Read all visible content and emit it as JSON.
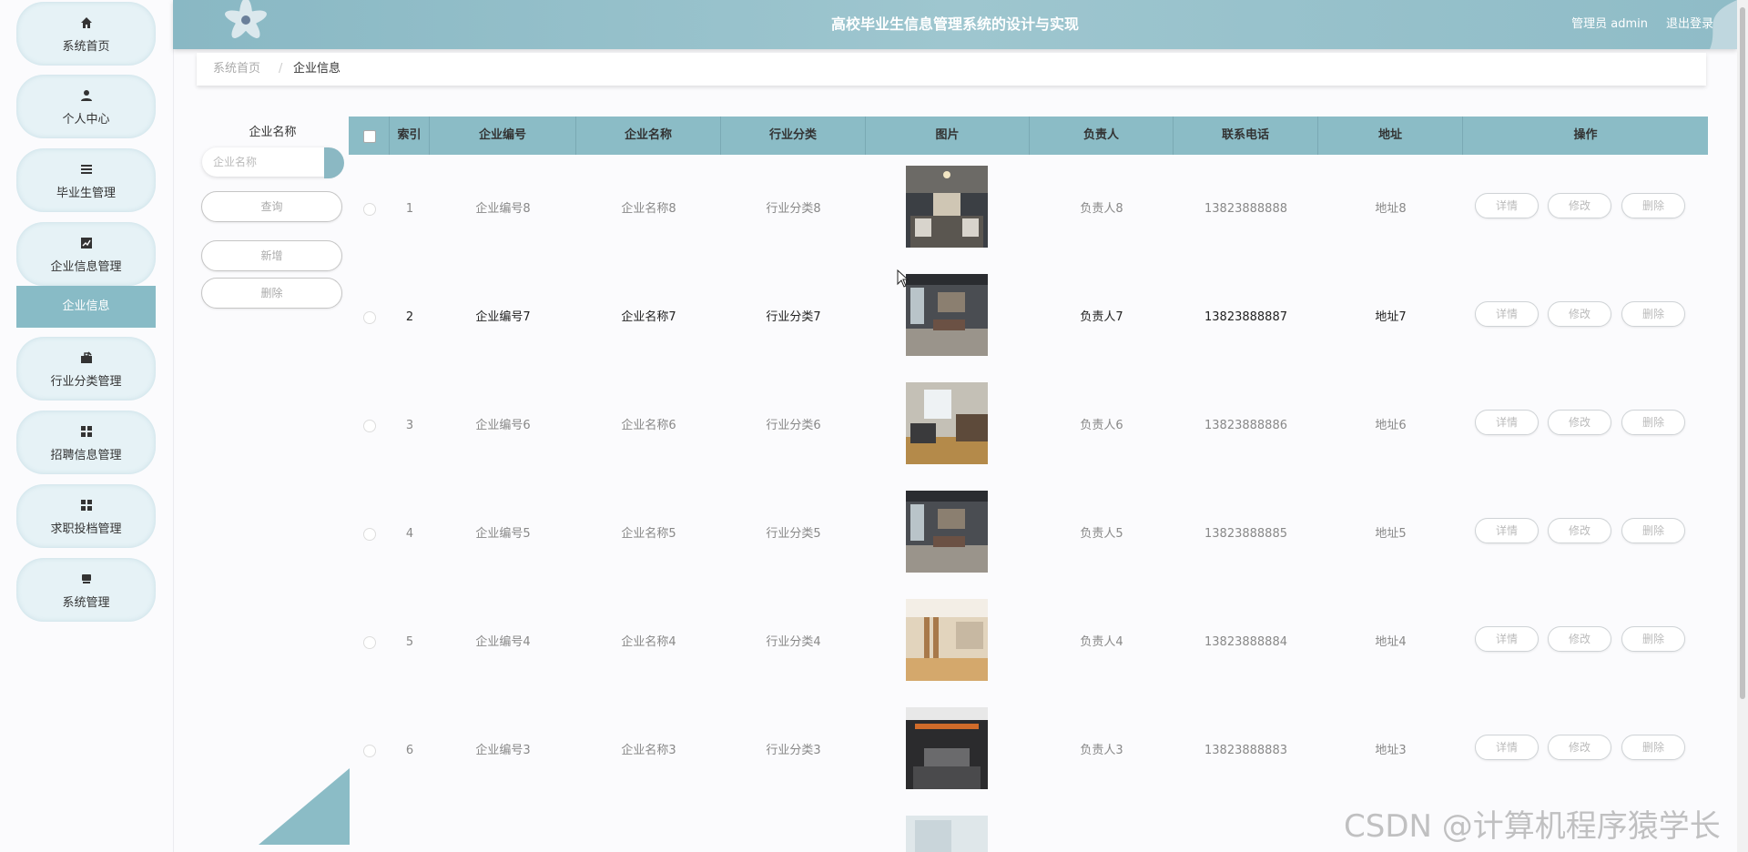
{
  "header": {
    "title": "高校毕业生信息管理系统的设计与实现",
    "user": "管理员 admin",
    "logout": "退出登录"
  },
  "sidebar": {
    "items": [
      {
        "label": "系统首页",
        "icon": "home-icon"
      },
      {
        "label": "个人中心",
        "icon": "user-icon"
      },
      {
        "label": "毕业生管理",
        "icon": "list-icon"
      },
      {
        "label": "企业信息管理",
        "icon": "chart-icon"
      },
      {
        "label": "行业分类管理",
        "icon": "briefcase-icon"
      },
      {
        "label": "招聘信息管理",
        "icon": "grid-icon"
      },
      {
        "label": "求职投档管理",
        "icon": "grid-icon"
      },
      {
        "label": "系统管理",
        "icon": "monitor-icon"
      }
    ],
    "active_sub": "企业信息"
  },
  "breadcrumb": {
    "home": "系统首页",
    "separator": "/",
    "current": "企业信息"
  },
  "search": {
    "label": "企业名称",
    "placeholder": "企业名称",
    "query": "查询",
    "add": "新增",
    "delete": "删除"
  },
  "table": {
    "headers": [
      "索引",
      "企业编号",
      "企业名称",
      "行业分类",
      "图片",
      "负责人",
      "联系电话",
      "地址",
      "操作"
    ],
    "rows": [
      {
        "index": "1",
        "code": "企业编号8",
        "name": "企业名称8",
        "category": "行业分类8",
        "manager": "负责人8",
        "phone": "13823888888",
        "address": "地址8",
        "image": "office-photo"
      },
      {
        "index": "2",
        "code": "企业编号7",
        "name": "企业名称7",
        "category": "行业分类7",
        "manager": "负责人7",
        "phone": "13823888887",
        "address": "地址7",
        "image": "office-photo"
      },
      {
        "index": "3",
        "code": "企业编号6",
        "name": "企业名称6",
        "category": "行业分类6",
        "manager": "负责人6",
        "phone": "13823888886",
        "address": "地址6",
        "image": "room-photo"
      },
      {
        "index": "4",
        "code": "企业编号5",
        "name": "企业名称5",
        "category": "行业分类5",
        "manager": "负责人5",
        "phone": "13823888885",
        "address": "地址5",
        "image": "office-photo"
      },
      {
        "index": "5",
        "code": "企业编号4",
        "name": "企业名称4",
        "category": "行业分类4",
        "manager": "负责人4",
        "phone": "13823888884",
        "address": "地址4",
        "image": "lobby-photo"
      },
      {
        "index": "6",
        "code": "企业编号3",
        "name": "企业名称3",
        "category": "行业分类3",
        "manager": "负责人3",
        "phone": "13823888883",
        "address": "地址3",
        "image": "meeting-photo"
      }
    ],
    "actions": {
      "detail": "详情",
      "edit": "修改",
      "delete": "删除"
    }
  },
  "watermark": "CSDN @计算机程序猿学长",
  "colors": {
    "accent": "#8bbcc6",
    "header": "#89b8c4",
    "menu_bg": "#e6f2f6"
  }
}
